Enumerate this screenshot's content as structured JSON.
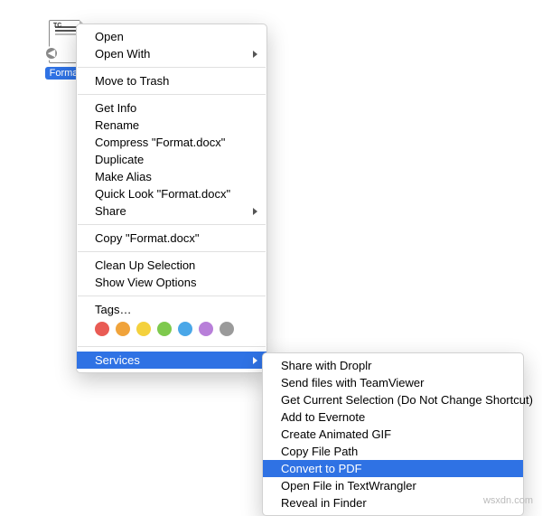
{
  "file": {
    "name": "Forma…",
    "badge_glyph": "◀",
    "thumb_label": "TC"
  },
  "menu": {
    "group1": [
      {
        "label": "Open",
        "arrow": false
      },
      {
        "label": "Open With",
        "arrow": true
      }
    ],
    "group2": [
      {
        "label": "Move to Trash"
      }
    ],
    "group3": [
      {
        "label": "Get Info"
      },
      {
        "label": "Rename"
      },
      {
        "label": "Compress \"Format.docx\""
      },
      {
        "label": "Duplicate"
      },
      {
        "label": "Make Alias"
      },
      {
        "label": "Quick Look \"Format.docx\""
      },
      {
        "label": "Share",
        "arrow": true
      }
    ],
    "group4": [
      {
        "label": "Copy \"Format.docx\""
      }
    ],
    "group5": [
      {
        "label": "Clean Up Selection"
      },
      {
        "label": "Show View Options"
      }
    ],
    "tags_label": "Tags…",
    "tag_colors": [
      "#e95b54",
      "#f0a33b",
      "#f4d13d",
      "#7ec94d",
      "#4aa7e8",
      "#b87fd9",
      "#9a9a9a"
    ],
    "services_label": "Services"
  },
  "submenu": {
    "items": [
      {
        "label": "Share with Droplr",
        "hl": false
      },
      {
        "label": "Send files with TeamViewer",
        "hl": false
      },
      {
        "label": "Get Current Selection (Do Not Change Shortcut)",
        "hl": false
      },
      {
        "label": "Add to Evernote",
        "hl": false
      },
      {
        "label": "Create Animated GIF",
        "hl": false
      },
      {
        "label": "Copy File Path",
        "hl": false
      },
      {
        "label": "Convert to PDF",
        "hl": true
      },
      {
        "label": "Open File in TextWrangler",
        "hl": false
      },
      {
        "label": "Reveal in Finder",
        "hl": false
      }
    ]
  },
  "watermark": "wsxdn.com"
}
